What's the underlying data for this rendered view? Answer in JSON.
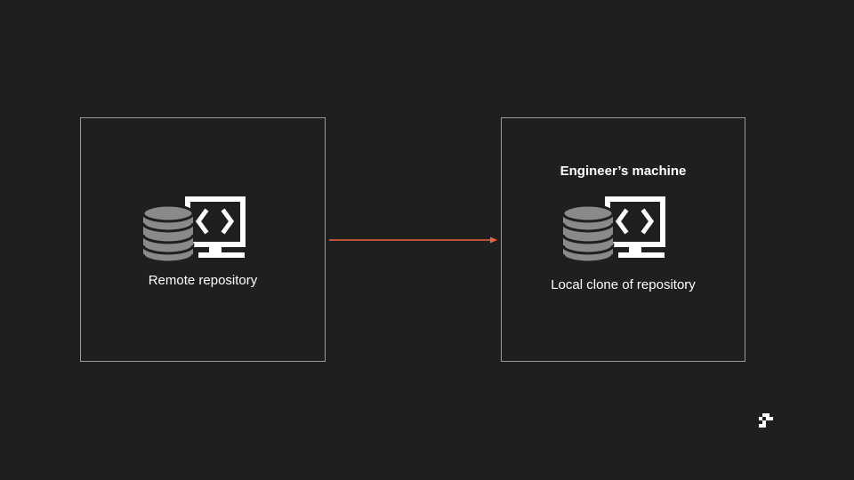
{
  "diagram": {
    "remote": {
      "label": "Remote repository",
      "icon": "repository-icon"
    },
    "local": {
      "title": "Engineer’s machine",
      "label": "Local clone of repository",
      "icon": "repository-icon"
    },
    "connector": {
      "from": "remote",
      "to": "local",
      "color": "#e8663d"
    }
  },
  "colors": {
    "background": "#1f1f1f",
    "box_border": "#9a9a9a",
    "text": "#ffffff",
    "database": "#8a8a8a"
  },
  "brand": {
    "icon": "brand-logo-icon"
  }
}
